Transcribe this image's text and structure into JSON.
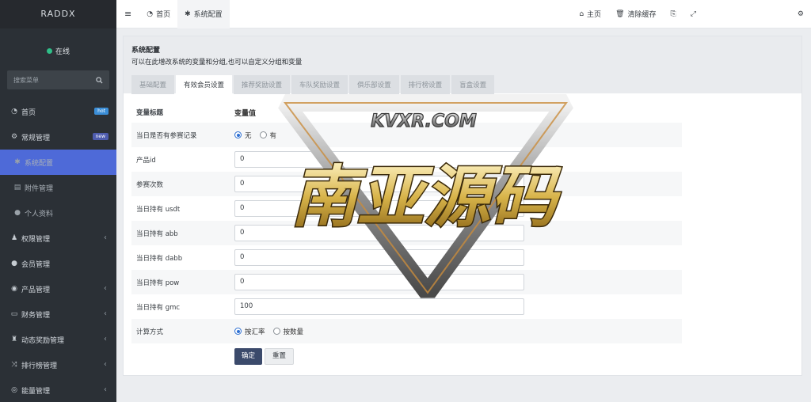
{
  "sidebar": {
    "brand": "RADDX",
    "status": "在线",
    "search_placeholder": "搜索菜单",
    "items": [
      {
        "label": "首页",
        "icon": "dashboard-icon",
        "badge": "hot"
      },
      {
        "label": "常规管理",
        "icon": "cogs-icon",
        "badge": "new"
      },
      {
        "label": "系统配置",
        "icon": "gear-icon",
        "active": true
      },
      {
        "label": "附件管理",
        "icon": "file-image-icon"
      },
      {
        "label": "个人资料",
        "icon": "user-icon"
      },
      {
        "label": "权限管理",
        "icon": "group-icon"
      },
      {
        "label": "会员管理",
        "icon": "user-icon"
      },
      {
        "label": "产品管理",
        "icon": "product-icon"
      },
      {
        "label": "财务管理",
        "icon": "credit-card-icon"
      },
      {
        "label": "动态奖励管理",
        "icon": "trophy-icon"
      },
      {
        "label": "排行榜管理",
        "icon": "shuffle-icon"
      },
      {
        "label": "能量管理",
        "icon": "bullseye-icon"
      }
    ]
  },
  "topbar": {
    "menu_icon": "bars-icon",
    "tabs": [
      {
        "label": "首页",
        "icon": "dashboard-icon"
      },
      {
        "label": "系统配置",
        "icon": "gear-icon"
      }
    ],
    "right": {
      "home_label": "主页",
      "clear_cache_label": "清除缓存"
    }
  },
  "panel": {
    "title": "系统配置",
    "description": "可以在此增改系统的变量和分组,也可以自定义分组和变量",
    "tabs": [
      "基础配置",
      "有效会员设置",
      "推荐奖励设置",
      "车队奖励设置",
      "俱乐部设置",
      "排行榜设置",
      "盲盒设置"
    ],
    "active_tab": 1,
    "headers": {
      "title": "变量标题",
      "value": "变量值"
    },
    "fields": [
      {
        "label": "当日是否有参赛记录",
        "type": "radio",
        "options": [
          "无",
          "有"
        ],
        "selected": 0
      },
      {
        "label": "产品id",
        "type": "text",
        "value": "0"
      },
      {
        "label": "参赛次数",
        "type": "text",
        "value": "0"
      },
      {
        "label": "当日持有 usdt",
        "type": "text",
        "value": "0"
      },
      {
        "label": "当日持有 abb",
        "type": "text",
        "value": "0"
      },
      {
        "label": "当日持有 dabb",
        "type": "text",
        "value": "0"
      },
      {
        "label": "当日持有 pow",
        "type": "text",
        "value": "0"
      },
      {
        "label": "当日持有 gmc",
        "type": "text",
        "value": "100"
      },
      {
        "label": "计算方式",
        "type": "radio",
        "options": [
          "按汇率",
          "按数量"
        ],
        "selected": 0
      }
    ],
    "buttons": {
      "submit": "确定",
      "reset": "重置"
    }
  },
  "watermark": {
    "site": "KVXR.COM",
    "name": "南亚源码"
  }
}
